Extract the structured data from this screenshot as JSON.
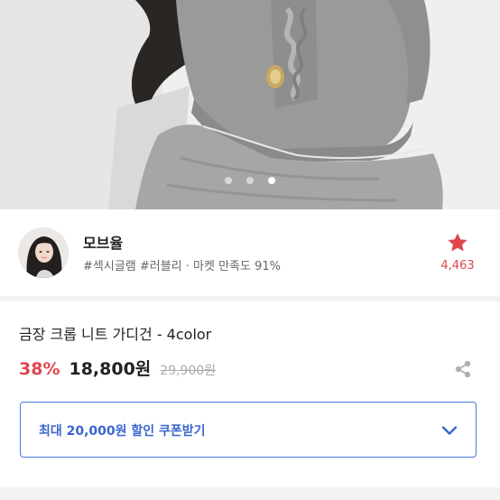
{
  "carousel": {
    "dot_count": 3,
    "active_index": 2
  },
  "shop": {
    "name": "모브율",
    "tags": "#섹시글램 #러블리 · 마켓 만족도 91%",
    "favorite_count": "4,463",
    "favorite_icon": "star-icon",
    "accent_color": "#e0454f"
  },
  "product": {
    "title": "금장 크롭 니트 가디건 - 4color",
    "discount": "38%",
    "price": "18,800원",
    "original_price": "29,900원",
    "share_icon": "share-icon"
  },
  "coupon": {
    "label": "최대 20,000원 할인 쿠폰받기",
    "icon": "chevron-down-icon",
    "color": "#3b66cf"
  }
}
